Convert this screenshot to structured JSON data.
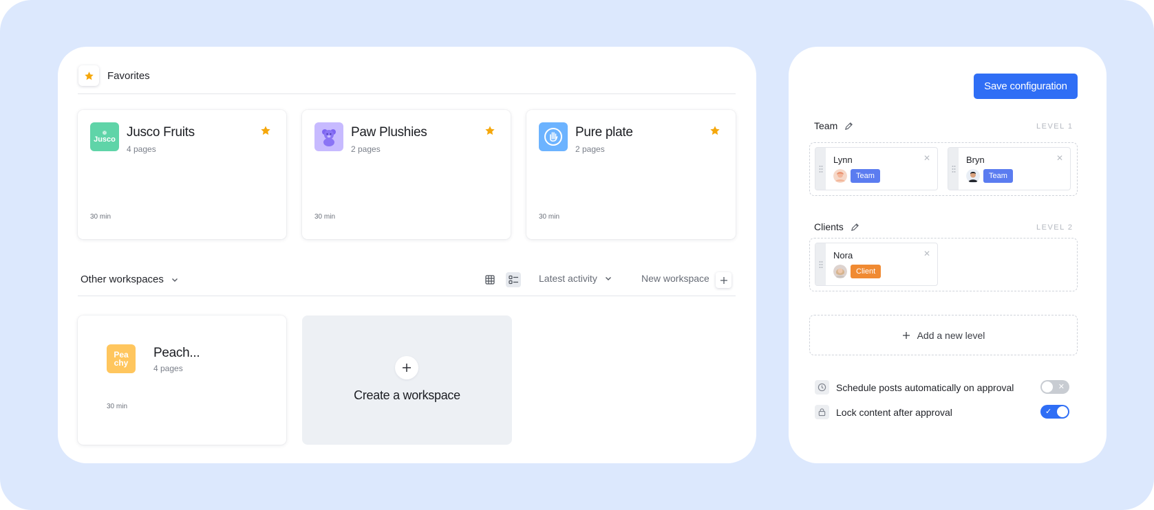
{
  "colors": {
    "background": "#dce8fd",
    "accent": "#2f6ef5",
    "star": "#f5a70b",
    "team_badge": "#5b7cf0",
    "client_badge": "#f08a32"
  },
  "favorites": {
    "title": "Favorites",
    "cards": [
      {
        "name": "Jusco Fruits",
        "pages": "4 pages",
        "time": "30 min",
        "logo_text": "Jusco",
        "logo_color": "#5fd4a8"
      },
      {
        "name": "Paw Plushies",
        "pages": "2 pages",
        "time": "30 min",
        "logo_icon": "teddy-bear-icon",
        "logo_color": "#c7baff"
      },
      {
        "name": "Pure plate",
        "pages": "2 pages",
        "time": "30 min",
        "logo_icon": "hand-icon",
        "logo_color": "#6cb3ff"
      }
    ]
  },
  "workspaces": {
    "title": "Other workspaces",
    "sort_label": "Latest activity",
    "new_label": "New workspace",
    "cards": [
      {
        "name": "Peach...",
        "pages": "4 pages",
        "time": "30 min",
        "logo_text_1": "Pea",
        "logo_text_2": "chy",
        "logo_color": "#ffc65e"
      }
    ],
    "create_label": "Create a workspace"
  },
  "config": {
    "save_label": "Save configuration",
    "levels": [
      {
        "name": "Team",
        "tag": "LEVEL 1",
        "members": [
          {
            "name": "Lynn",
            "badge": "Team"
          },
          {
            "name": "Bryn",
            "badge": "Team"
          }
        ]
      },
      {
        "name": "Clients",
        "tag": "LEVEL 2",
        "members": [
          {
            "name": "Nora",
            "badge": "Client"
          }
        ]
      }
    ],
    "add_level_label": "Add a new level",
    "options": [
      {
        "label": "Schedule posts automatically on approval",
        "enabled": false
      },
      {
        "label": "Lock content after approval",
        "enabled": true
      }
    ]
  }
}
